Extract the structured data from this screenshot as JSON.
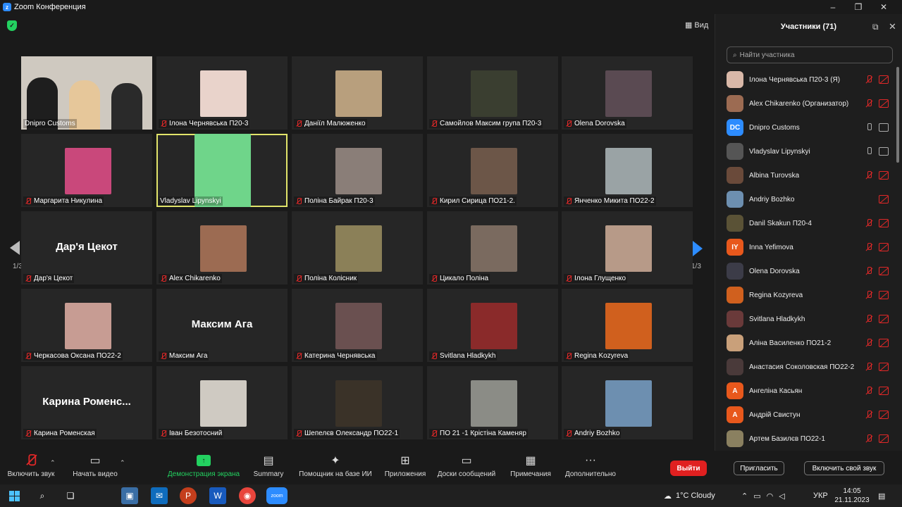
{
  "window": {
    "title": "Zoom Конференция",
    "minimize": "–",
    "maximize": "❐",
    "close": "✕"
  },
  "view_label": "Вид",
  "pager": {
    "left": "1/3",
    "right": "1/3"
  },
  "tiles": [
    {
      "name": "Dnipro Customs",
      "muted": false,
      "type": "group",
      "color": "#cfc9c0"
    },
    {
      "name": "Ілона Чернявська П20-3",
      "muted": true,
      "type": "pic",
      "color": "#e9d3cb"
    },
    {
      "name": "Даніїл Малюженко",
      "muted": true,
      "type": "pic",
      "color": "#b89f7d"
    },
    {
      "name": "Самойлов Максим група П20-3",
      "muted": true,
      "type": "pic",
      "color": "#3a3e30"
    },
    {
      "name": "Olena Dorovska",
      "muted": true,
      "type": "pic",
      "color": "#5a4a52"
    },
    {
      "name": "Маргарита Никулина",
      "muted": true,
      "type": "pic",
      "color": "#c9487b"
    },
    {
      "name": "Vladyslav Lipynskyi",
      "muted": false,
      "type": "active",
      "color": "#6fd58a"
    },
    {
      "name": "Поліна Байрак П20-3",
      "muted": true,
      "type": "pic",
      "color": "#8a7e78"
    },
    {
      "name": "Кирил Сирица ПО21-2.",
      "muted": true,
      "type": "pic",
      "color": "#6c5648"
    },
    {
      "name": "Янченко Микита ПО22-2",
      "muted": true,
      "type": "pic",
      "color": "#9aa3a5"
    },
    {
      "name": "Дар'я Цекот",
      "muted": true,
      "type": "text",
      "big": "Дар'я Цекот"
    },
    {
      "name": "Alex Chikarenko",
      "muted": true,
      "type": "pic",
      "color": "#9c6b52"
    },
    {
      "name": "Поліна Колісник",
      "muted": true,
      "type": "pic",
      "color": "#8b8058"
    },
    {
      "name": "Цикало Поліна",
      "muted": true,
      "type": "pic",
      "color": "#7a6a5f"
    },
    {
      "name": "Ілона Глущенко",
      "muted": true,
      "type": "pic",
      "color": "#b79a88"
    },
    {
      "name": "Черкасова Оксана ПО22-2",
      "muted": true,
      "type": "pic",
      "color": "#c79c93"
    },
    {
      "name": "Максим Ага",
      "muted": true,
      "type": "text",
      "big": "Максим Ага"
    },
    {
      "name": "Катерина Чернявська",
      "muted": true,
      "type": "pic",
      "color": "#6a5050"
    },
    {
      "name": "Svitlana Hladkykh",
      "muted": true,
      "type": "pic",
      "color": "#8a2a2a"
    },
    {
      "name": "Regina Kozyreva",
      "muted": true,
      "type": "pic",
      "color": "#d0601e"
    },
    {
      "name": "Карина Роменская",
      "muted": true,
      "type": "text",
      "big": "Карина  Роменс..."
    },
    {
      "name": "Іван Безотосний",
      "muted": true,
      "type": "pic",
      "color": "#cfcac2"
    },
    {
      "name": "Шепелєв Олександр  ПО22-1",
      "muted": true,
      "type": "pic",
      "color": "#3a3228"
    },
    {
      "name": "ПО 21 -1 Крістіна Каменяр",
      "muted": true,
      "type": "pic",
      "color": "#8b8c86"
    },
    {
      "name": "Andriy Bozhko",
      "muted": true,
      "type": "pic",
      "color": "#6d8fb0"
    }
  ],
  "panel": {
    "title": "Участники (71)",
    "search_placeholder": "Найти участника",
    "invite": "Пригласить",
    "unmute_self": "Включить свой звук"
  },
  "participants": [
    {
      "name": "Ілона Чернявська П20-3 (Я)",
      "av": "",
      "color": "#d9b8a8",
      "mic": "muted",
      "cam": "off"
    },
    {
      "name": "Alex Chikarenko (Организатор)",
      "av": "",
      "color": "#9c6b52",
      "mic": "muted",
      "cam": "off"
    },
    {
      "name": "Dnipro Customs",
      "av": "DC",
      "color": "#2d8cff",
      "mic": "on",
      "cam": "on"
    },
    {
      "name": "Vladyslav Lipynskyi",
      "av": "",
      "color": "#555",
      "mic": "on",
      "cam": "on"
    },
    {
      "name": "Albina Turovska",
      "av": "",
      "color": "#6a4a3a",
      "mic": "muted",
      "cam": "off"
    },
    {
      "name": "Andriy Bozhko",
      "av": "",
      "color": "#6d8fb0",
      "mic": "",
      "cam": "off"
    },
    {
      "name": "Danil Skakun П20-4",
      "av": "",
      "color": "#5a5236",
      "mic": "muted",
      "cam": "off"
    },
    {
      "name": "Inna Yefimova",
      "av": "IY",
      "color": "#e8581c",
      "mic": "muted",
      "cam": "off"
    },
    {
      "name": "Olena Dorovska",
      "av": "",
      "color": "#3c3c48",
      "mic": "muted",
      "cam": "off"
    },
    {
      "name": "Regina Kozyreva",
      "av": "",
      "color": "#d0601e",
      "mic": "muted",
      "cam": "off"
    },
    {
      "name": "Svitlana Hladkykh",
      "av": "",
      "color": "#6a3a3a",
      "mic": "muted",
      "cam": "off"
    },
    {
      "name": "Аліна Василенко ПО21-2",
      "av": "",
      "color": "#c9a07a",
      "mic": "muted",
      "cam": "off"
    },
    {
      "name": "Анастасия Соколовская ПО22-2",
      "av": "",
      "color": "#4a3a3a",
      "mic": "muted",
      "cam": "off"
    },
    {
      "name": "Ангеліна Касьян",
      "av": "А",
      "color": "#e8581c",
      "mic": "muted",
      "cam": "off"
    },
    {
      "name": "Андрій Свистун",
      "av": "А",
      "color": "#e8581c",
      "mic": "muted",
      "cam": "off"
    },
    {
      "name": "Артем Базилєв ПО22-1",
      "av": "",
      "color": "#8a8060",
      "mic": "muted",
      "cam": "off"
    }
  ],
  "toolbar": {
    "unmute": "Включить звук",
    "start_video": "Начать видео",
    "share": "Демонстрация экрана",
    "summary": "Summary",
    "ai": "Помощник на базе ИИ",
    "apps": "Приложения",
    "whiteboard": "Доски сообщений",
    "notes": "Примечания",
    "more": "Дополнительно",
    "exit": "Выйти"
  },
  "taskbar": {
    "weather": "1°C  Cloudy",
    "lang": "УКР",
    "time": "14:05",
    "date": "21.11.2023"
  }
}
